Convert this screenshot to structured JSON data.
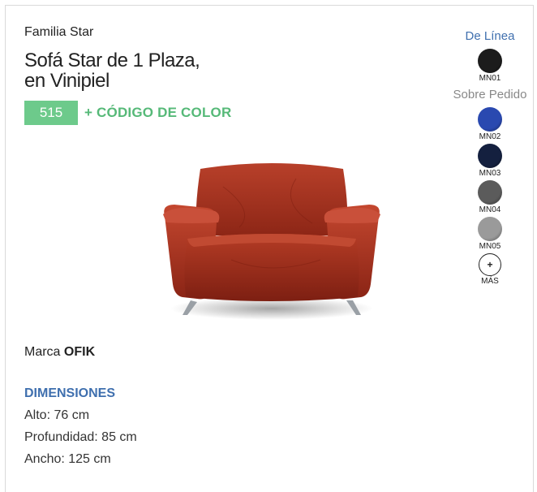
{
  "product": {
    "family": "Familia Star",
    "title_line1": "Sofá Star de 1 Plaza,",
    "title_line2": "en Vinipiel",
    "code": "515",
    "code_suffix": "+ CÓDIGO DE COLOR",
    "image_icon": "armchair-photo"
  },
  "colors": {
    "line_label": "De Línea",
    "order_label": "Sobre Pedido",
    "line_swatches": [
      {
        "code": "MN01",
        "color": "#1c1c1c"
      }
    ],
    "order_swatches": [
      {
        "code": "MN02",
        "color": "#2a49b0"
      },
      {
        "code": "MN03",
        "color": "#14203f"
      },
      {
        "code": "MN04",
        "color": "#5b5b5b"
      },
      {
        "code": "MN05",
        "color": "#9a9a9a"
      }
    ],
    "more_symbol": "+",
    "more_label": "MÁS"
  },
  "brand": {
    "prefix": "Marca",
    "name": "OFIK"
  },
  "dimensions": {
    "heading": "DIMENSIONES",
    "alto": "Alto: 76 cm",
    "profundidad": "Profundidad: 85 cm",
    "ancho": "Ancho: 125 cm"
  },
  "theme": {
    "accent_green": "#6dca8b",
    "accent_blue": "#3f6fae",
    "sofa_red": "#a8321f"
  }
}
